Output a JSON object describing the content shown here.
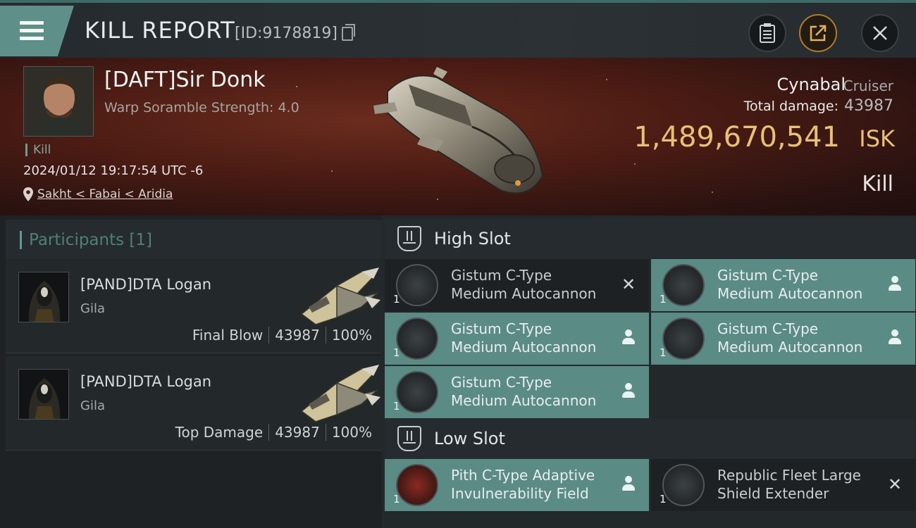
{
  "header": {
    "title": "KILL REPORT",
    "id_label": "[ID:9178819]"
  },
  "victim": {
    "name": "[DAFT]Sir Donk",
    "warp_scramble": "Warp Soramble Strength: 4.0",
    "tag": "Kill",
    "datetime": "2024/01/12 19:17:54 UTC -6",
    "location": "Sakht < Fabai < Aridia",
    "ship_name": "Cynabal",
    "ship_class": "Cruiser",
    "total_damage_label": "Total damage:",
    "total_damage": "43987",
    "isk_value": "1,489,670,541",
    "isk_unit": "ISK",
    "kill_type": "Kill"
  },
  "participants": {
    "header": "Participants [1]",
    "rows": [
      {
        "name": "[PAND]DTA Logan",
        "ship": "Gila",
        "role": "Final Blow",
        "damage": "43987",
        "percent": "100%"
      },
      {
        "name": "[PAND]DTA Logan",
        "ship": "Gila",
        "role": "Top Damage",
        "damage": "43987",
        "percent": "100%"
      }
    ]
  },
  "fitting": {
    "high_slot_label": "High Slot",
    "low_slot_label": "Low Slot",
    "high_modules": [
      {
        "line1": "Gistum C-Type",
        "line2": "Medium Autocannon",
        "qty": "1",
        "status": "destroyed"
      },
      {
        "line1": "Gistum C-Type",
        "line2": "Medium Autocannon",
        "qty": "1",
        "status": "dropped"
      },
      {
        "line1": "Gistum C-Type",
        "line2": "Medium Autocannon",
        "qty": "1",
        "status": "dropped"
      },
      {
        "line1": "Gistum C-Type",
        "line2": "Medium Autocannon",
        "qty": "1",
        "status": "dropped"
      },
      {
        "line1": "Gistum C-Type",
        "line2": "Medium Autocannon",
        "qty": "1",
        "status": "dropped"
      }
    ],
    "low_modules": [
      {
        "line1": "Pith C-Type Adaptive",
        "line2": "Invulnerability Field",
        "qty": "1",
        "status": "dropped"
      },
      {
        "line1": "Republic Fleet Large",
        "line2": "Shield Extender",
        "qty": "1",
        "status": "destroyed"
      }
    ]
  },
  "colors": {
    "accent_teal": "#5b8b85",
    "isk_gold": "#e8c078",
    "hero_red": "#4c1c14"
  }
}
